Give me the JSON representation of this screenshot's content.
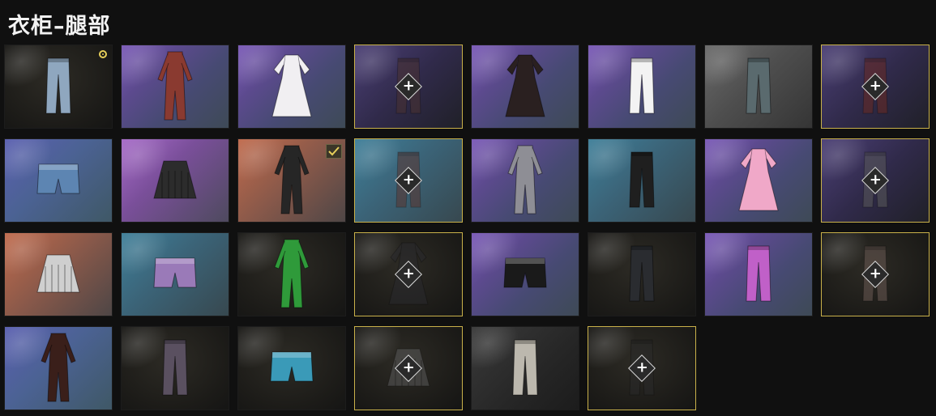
{
  "page": {
    "title": "衣柜–腿部"
  },
  "colors": {
    "accent": "#c9b14a",
    "equipped": "#e7cf5a"
  },
  "items": [
    {
      "name": "item-blue-cargo-pants",
      "bg": "bg-dark",
      "type": "pants",
      "color": "#8fa7bf",
      "locked": false,
      "equipped": true,
      "selected": false
    },
    {
      "name": "item-red-muscle-suit",
      "bg": "bg-purple",
      "type": "suit",
      "color": "#8a3a30",
      "locked": false,
      "equipped": false,
      "selected": false
    },
    {
      "name": "item-sailor-dress",
      "bg": "bg-purple",
      "type": "dress",
      "color": "#f1eff2",
      "locked": false,
      "equipped": false,
      "selected": false
    },
    {
      "name": "item-locked-dark-pants",
      "bg": "bg-navy",
      "type": "pants",
      "color": "#4a3230",
      "locked": true,
      "equipped": false,
      "selected": false
    },
    {
      "name": "item-black-lace-dress",
      "bg": "bg-purple",
      "type": "dress",
      "color": "#2a2020",
      "locked": false,
      "equipped": false,
      "selected": false
    },
    {
      "name": "item-white-pants",
      "bg": "bg-purple",
      "type": "pants",
      "color": "#f3f3f3",
      "locked": false,
      "equipped": false,
      "selected": false
    },
    {
      "name": "item-grey-jeans",
      "bg": "bg-grey",
      "type": "pants",
      "color": "#5a6a6e",
      "locked": false,
      "equipped": false,
      "selected": false
    },
    {
      "name": "item-locked-flare-pants",
      "bg": "bg-navy",
      "type": "pants",
      "color": "#6a2a22",
      "locked": true,
      "equipped": false,
      "selected": false
    },
    {
      "name": "item-denim-shorts-apron",
      "bg": "bg-blue",
      "type": "shorts",
      "color": "#5d85b2",
      "locked": false,
      "equipped": false,
      "selected": false
    },
    {
      "name": "item-plaid-skirt-black",
      "bg": "bg-pink",
      "type": "skirt",
      "color": "#2c2c2c",
      "locked": false,
      "equipped": false,
      "selected": false
    },
    {
      "name": "item-black-outfit-selected",
      "bg": "bg-orange",
      "type": "suit",
      "color": "#262626",
      "locked": false,
      "equipped": false,
      "selected": true
    },
    {
      "name": "item-locked-brown-pants",
      "bg": "bg-teal",
      "type": "pants",
      "color": "#5a3530",
      "locked": true,
      "equipped": false,
      "selected": false
    },
    {
      "name": "item-grey-jumpsuit",
      "bg": "bg-purple",
      "type": "suit",
      "color": "#8e8e95",
      "locked": false,
      "equipped": false,
      "selected": false
    },
    {
      "name": "item-black-dragon-pants",
      "bg": "bg-teal",
      "type": "pants",
      "color": "#1f1f1f",
      "locked": false,
      "equipped": false,
      "selected": false
    },
    {
      "name": "item-pink-dress",
      "bg": "bg-purple",
      "type": "dress",
      "color": "#f0a8c8",
      "locked": false,
      "equipped": false,
      "selected": false
    },
    {
      "name": "item-locked-grey-pants",
      "bg": "bg-navy",
      "type": "pants",
      "color": "#5a5a5a",
      "locked": true,
      "equipped": false,
      "selected": false
    },
    {
      "name": "item-plaid-skirt-grey",
      "bg": "bg-orange",
      "type": "skirt",
      "color": "#cfcfcf",
      "locked": false,
      "equipped": false,
      "selected": false
    },
    {
      "name": "item-purple-shorts",
      "bg": "bg-teal",
      "type": "shorts",
      "color": "#9a7ab8",
      "locked": false,
      "equipped": false,
      "selected": false
    },
    {
      "name": "item-green-suit",
      "bg": "bg-dark",
      "type": "suit",
      "color": "#2f9a3a",
      "locked": false,
      "equipped": false,
      "selected": false
    },
    {
      "name": "item-locked-dark-dress",
      "bg": "bg-dark",
      "type": "dress",
      "color": "#2a2a2e",
      "locked": true,
      "equipped": false,
      "selected": false
    },
    {
      "name": "item-black-shorts",
      "bg": "bg-purple",
      "type": "shorts",
      "color": "#1a1a1a",
      "locked": false,
      "equipped": false,
      "selected": false
    },
    {
      "name": "item-black-cargo-pants",
      "bg": "bg-dark",
      "type": "pants",
      "color": "#2a2c30",
      "locked": false,
      "equipped": false,
      "selected": false
    },
    {
      "name": "item-pink-metallic-pants",
      "bg": "bg-purple",
      "type": "pants",
      "color": "#c060c8",
      "locked": false,
      "equipped": false,
      "selected": false
    },
    {
      "name": "item-locked-tan-pants",
      "bg": "bg-dark",
      "type": "pants",
      "color": "#6a5a54",
      "locked": true,
      "equipped": false,
      "selected": false
    },
    {
      "name": "item-bodysuit",
      "bg": "bg-blue",
      "type": "suit",
      "color": "#3a1f1a",
      "locked": false,
      "equipped": false,
      "selected": false
    },
    {
      "name": "item-camo-pants",
      "bg": "bg-dark",
      "type": "pants",
      "color": "#5a5060",
      "locked": false,
      "equipped": false,
      "selected": false
    },
    {
      "name": "item-blue-shorts",
      "bg": "bg-dark",
      "type": "shorts",
      "color": "#3a9ab8",
      "locked": false,
      "equipped": false,
      "selected": false
    },
    {
      "name": "item-locked-grey-skirt",
      "bg": "bg-dark",
      "type": "skirt",
      "color": "#5a5a5a",
      "locked": true,
      "equipped": false,
      "selected": false
    },
    {
      "name": "item-beige-pants",
      "bg": "bg-greydark",
      "type": "pants",
      "color": "#bcb8ae",
      "locked": false,
      "equipped": false,
      "selected": false
    },
    {
      "name": "item-locked-black-pants",
      "bg": "bg-dark",
      "type": "pants",
      "color": "#2a2a2a",
      "locked": true,
      "equipped": false,
      "selected": false
    }
  ]
}
